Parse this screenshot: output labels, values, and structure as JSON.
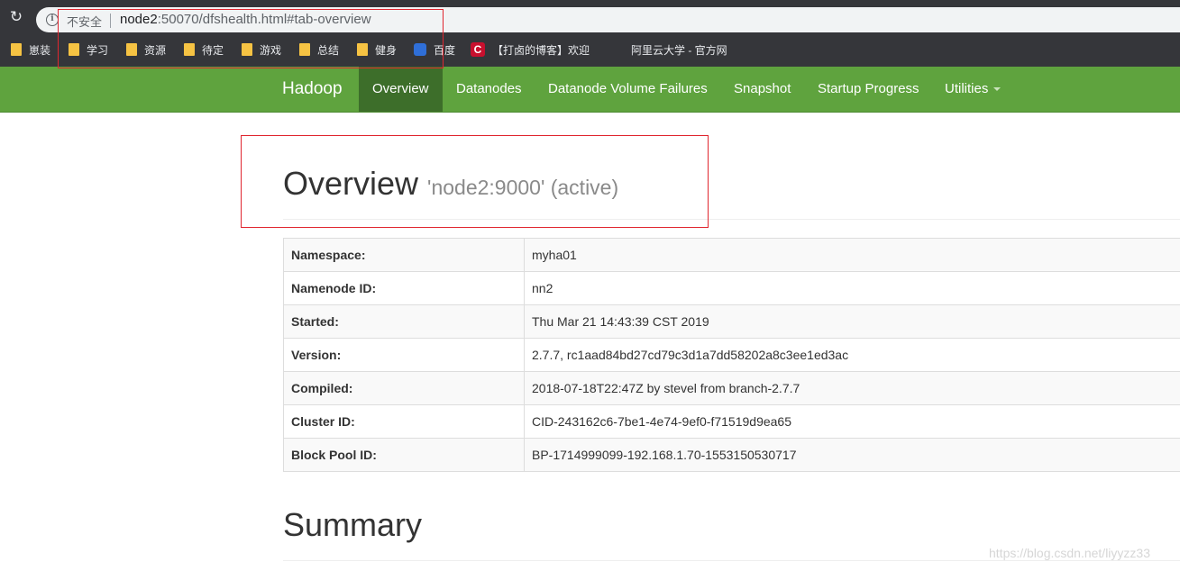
{
  "browser": {
    "security_label": "不安全",
    "url_host": "node2",
    "url_rest": ":50070/dfshealth.html#tab-overview",
    "bookmarks": [
      "崽装",
      "学习",
      "资源",
      "待定",
      "游戏",
      "总结",
      "健身",
      "百度",
      "【打卤的博客】欢迎",
      "阿里云大学 - 官方网"
    ]
  },
  "navbar": {
    "brand": "Hadoop",
    "items": [
      "Overview",
      "Datanodes",
      "Datanode Volume Failures",
      "Snapshot",
      "Startup Progress",
      "Utilities"
    ],
    "active": "Overview",
    "color": "#5fa33e"
  },
  "overview": {
    "title": "Overview",
    "subtitle": "'node2:9000' (active)",
    "rows": [
      {
        "key": "Namespace:",
        "value": "myha01"
      },
      {
        "key": "Namenode ID:",
        "value": "nn2"
      },
      {
        "key": "Started:",
        "value": "Thu Mar 21 14:43:39 CST 2019"
      },
      {
        "key": "Version:",
        "value": "2.7.7, rc1aad84bd27cd79c3d1a7dd58202a8c3ee1ed3ac"
      },
      {
        "key": "Compiled:",
        "value": "2018-07-18T22:47Z by stevel from branch-2.7.7"
      },
      {
        "key": "Cluster ID:",
        "value": "CID-243162c6-7be1-4e74-9ef0-f71519d9ea65"
      },
      {
        "key": "Block Pool ID:",
        "value": "BP-1714999099-192.168.1.70-1553150530717"
      }
    ]
  },
  "summary": {
    "title": "Summary"
  },
  "watermark": "https://blog.csdn.net/liyyzz33"
}
